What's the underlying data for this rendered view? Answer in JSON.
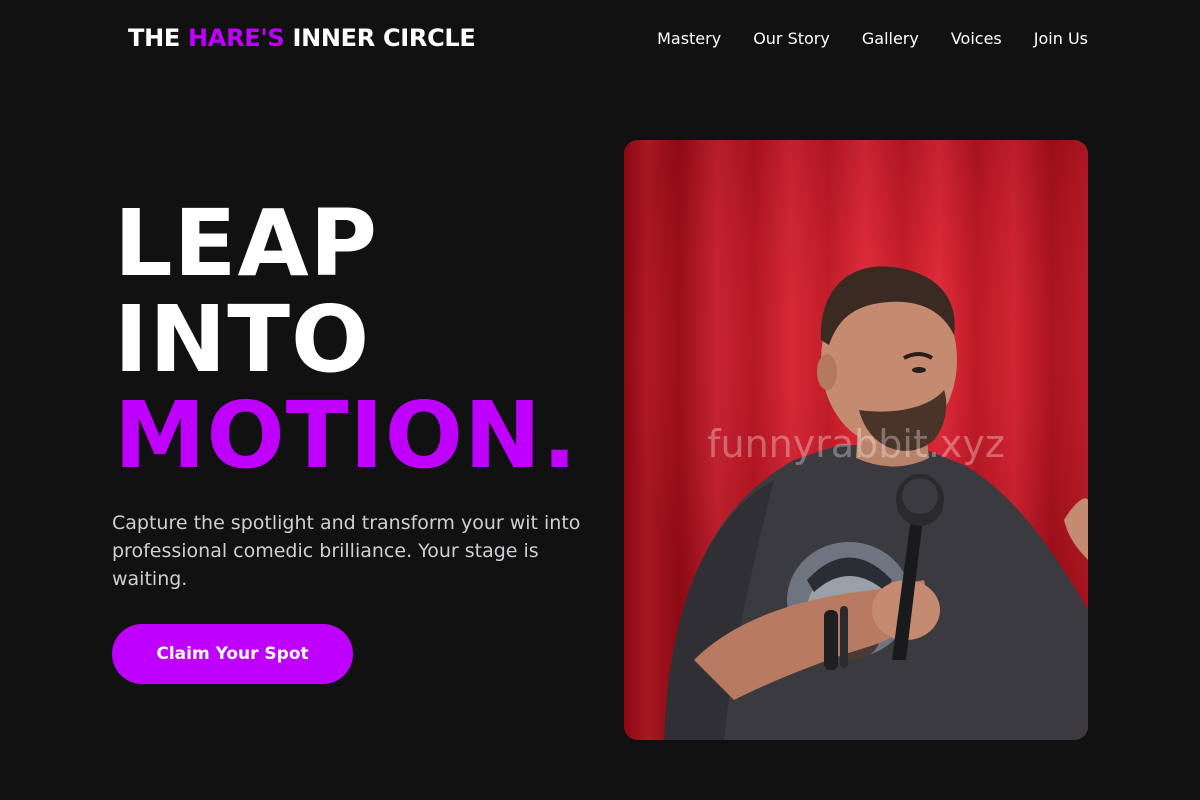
{
  "header": {
    "logo": {
      "prefix": "THE ",
      "accent": "HARE'S",
      "suffix": " INNER CIRCLE"
    },
    "nav": [
      {
        "label": "Mastery"
      },
      {
        "label": "Our Story"
      },
      {
        "label": "Gallery"
      },
      {
        "label": "Voices"
      },
      {
        "label": "Join Us"
      }
    ]
  },
  "hero": {
    "headline": {
      "line1": "LEAP",
      "line2": "INTO",
      "line3": "MOTION."
    },
    "subtext": "Capture the spotlight and transform your wit into professional comedic brilliance. Your stage is waiting.",
    "cta_label": "Claim Your Spot"
  },
  "photo": {
    "watermark": "funnyrabbit.xyz"
  },
  "colors": {
    "background": "#111112",
    "accent": "#bf00ff",
    "text": "#ffffff",
    "muted_text": "#cfcfd4",
    "curtain": "#c4121d"
  }
}
